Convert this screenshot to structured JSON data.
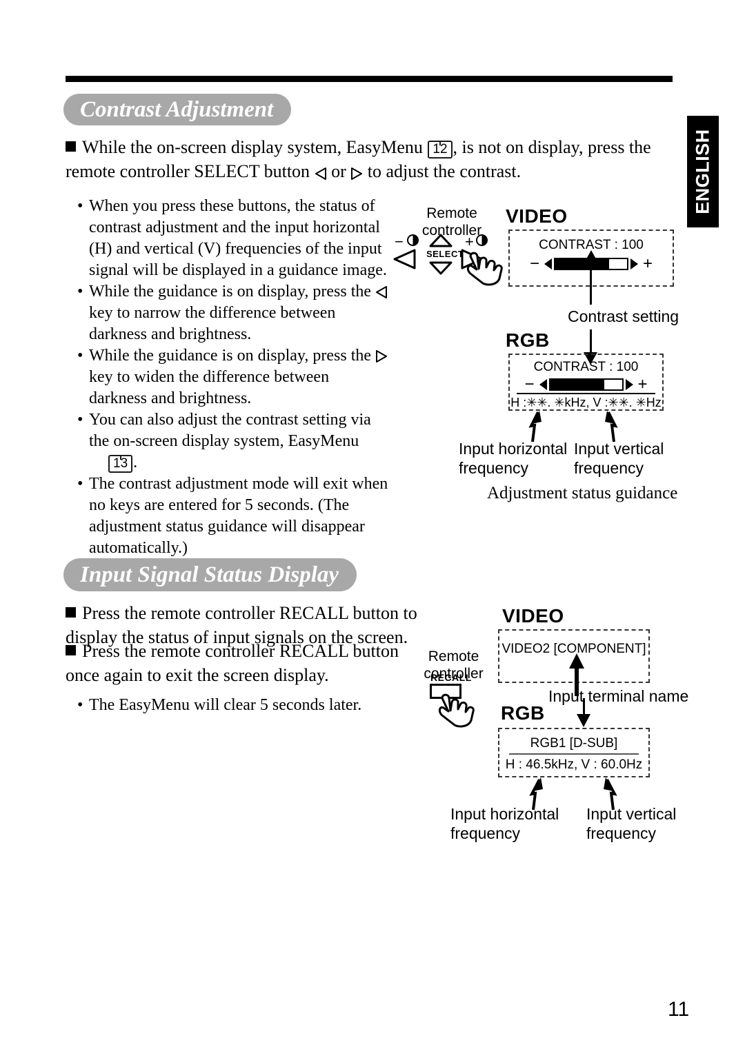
{
  "page": {
    "language_tab": "ENGLISH",
    "page_number": "11"
  },
  "sections": [
    {
      "title": "Contrast Adjustment",
      "lead": {
        "before_ref": "While the on-screen display system, EasyMenu ",
        "ref": "12",
        "after_ref": ", is not on display, press the remote controller SELECT button ",
        "tail": " to adjust the contrast.",
        "mid": " or "
      },
      "notes": [
        "When you press these buttons, the status of contrast adjustment and the input horizontal (H) and vertical (V) frequencies of the input signal will be displayed in a guidance image.",
        "While the guidance is on display, press the  key to narrow the difference between darkness and brightness.",
        "While the guidance is on display, press the  key to widen the difference between darkness and brightness.",
        "You can also adjust the contrast setting via the on-screen display system, EasyMenu",
        "The contrast adjustment mode will exit when no keys are entered for 5 seconds. (The adjustment status guidance will disappear automatically.)"
      ],
      "note4_ref": "13",
      "note4_period": ".",
      "diagram": {
        "remote_label_line1": "Remote",
        "remote_label_line2": "controller",
        "key_minus_sign": "−",
        "key_plus_sign": "+",
        "select_label": "SELECT",
        "video_head": "VIDEO",
        "rgb_head": "RGB",
        "video_osd_contrast": "CONTRAST : 100",
        "rgb_osd_contrast": "CONTRAST : 100",
        "rgb_osd_freq": "H :✳✳. ✳kHz, V :✳✳. ✳Hz",
        "slider_minus": "−",
        "slider_plus": "+",
        "slider_fill_percent": 75,
        "callout_contrast_setting": "Contrast setting",
        "callout_input_h": "Input horizontal",
        "callout_input_h2": "frequency",
        "callout_input_v": "Input vertical",
        "callout_input_v2": "frequency",
        "callout_guidance": "Adjustment status guidance"
      }
    },
    {
      "title": "Input Signal Status Display",
      "items": [
        "Press the remote controller RECALL button to display the status of input signals on the screen.",
        "Press the remote controller RECALL button once again to exit the screen display."
      ],
      "notes": [
        "The EasyMenu will clear 5 seconds later."
      ],
      "diagram": {
        "remote_label_line1": "Remote",
        "remote_label_line2": "controller",
        "recall_key_label": "RECALL",
        "video_head": "VIDEO",
        "rgb_head": "RGB",
        "video_osd_terminal": "VIDEO2  [COMPONENT]",
        "rgb_osd_terminal": "RGB1  [D-SUB]",
        "rgb_osd_freq": "H : 46.5kHz, V : 60.0Hz",
        "callout_terminal": "Input terminal name",
        "callout_input_h": "Input horizontal",
        "callout_input_h2": "frequency",
        "callout_input_v": "Input vertical",
        "callout_input_v2": "frequency"
      }
    }
  ],
  "colors": {
    "pill_bg": "#a8a8a8",
    "ink": "#000000",
    "tab_bg": "#000000"
  }
}
